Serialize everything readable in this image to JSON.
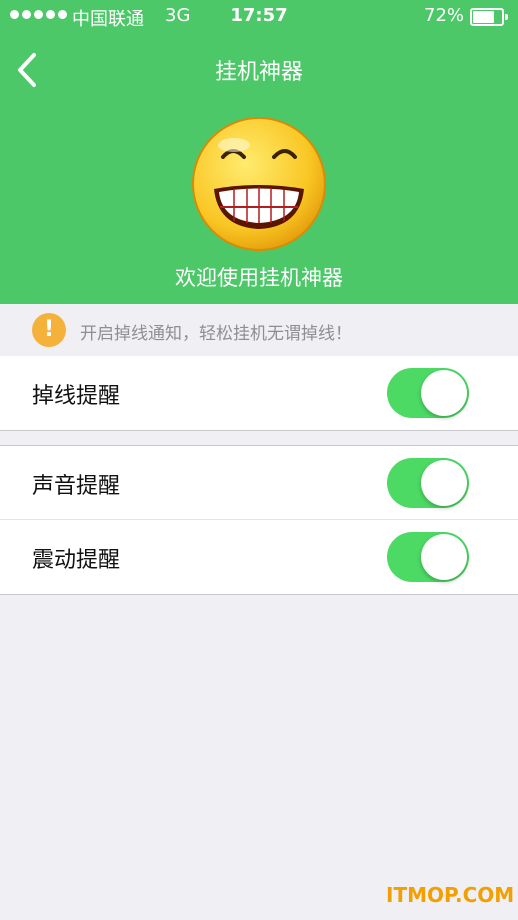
{
  "status_bar": {
    "carrier": "中国联通",
    "network": "3G",
    "time": "17:57",
    "battery": "72%"
  },
  "nav": {
    "title": "挂机神器",
    "back_icon": "chevron-left-icon"
  },
  "hero": {
    "emoji_icon": "grinning-face-icon",
    "welcome": "欢迎使用挂机神器"
  },
  "notice": {
    "icon": "warning-icon",
    "icon_glyph": "!",
    "text": "开启掉线通知，轻松挂机无谓掉线！"
  },
  "settings": [
    {
      "label": "掉线提醒",
      "enabled": true
    },
    {
      "label": "声音提醒",
      "enabled": true
    },
    {
      "label": "震动提醒",
      "enabled": true
    }
  ],
  "watermark": "ITMOP.COM",
  "colors": {
    "header_green": "#4cc869",
    "switch_green": "#4cd964",
    "warning_orange": "#f5b23b",
    "background": "#efeff4"
  }
}
